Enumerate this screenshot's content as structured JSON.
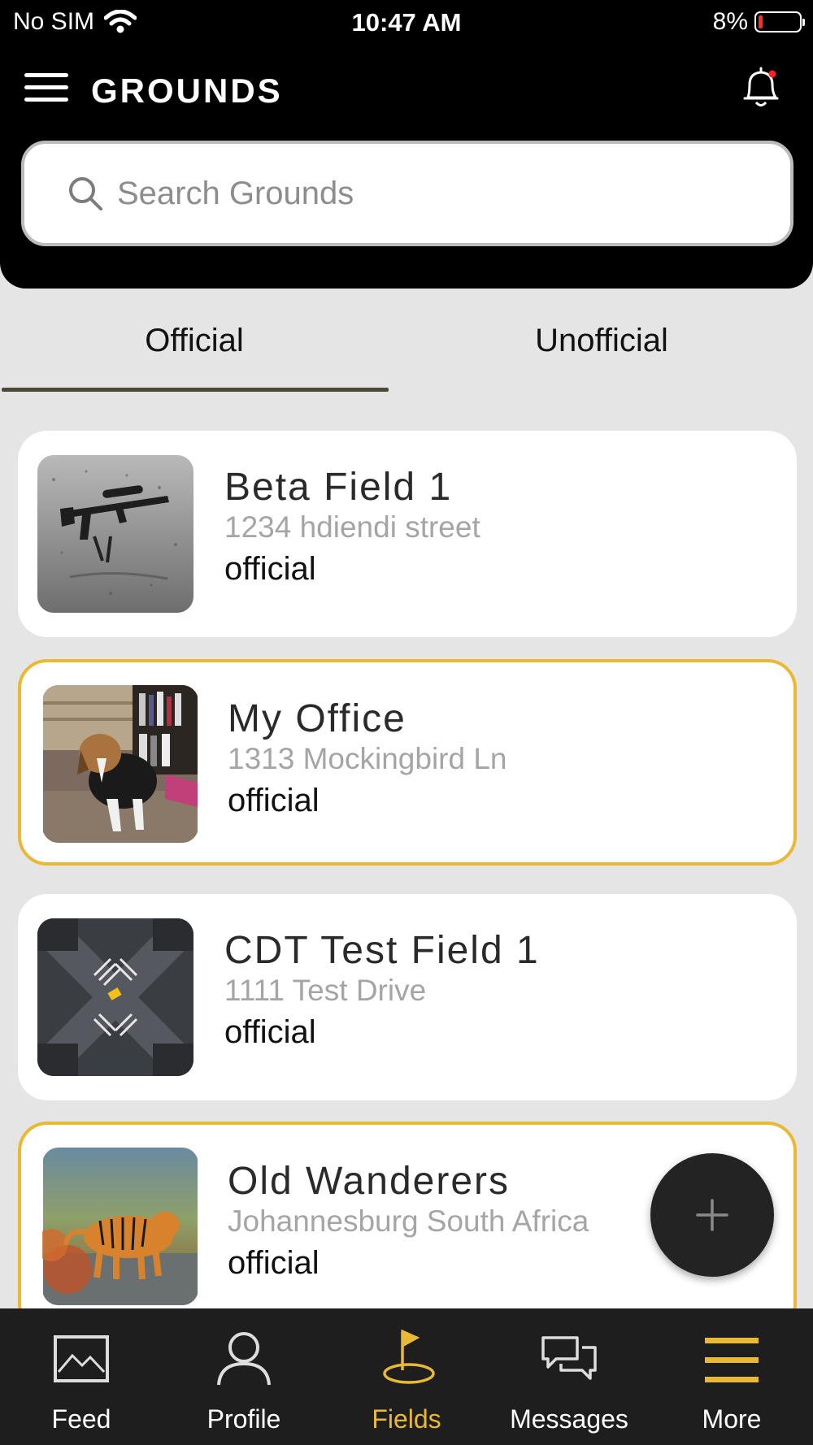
{
  "status_bar": {
    "carrier": "No SIM",
    "time": "10:47 AM",
    "battery": "8%"
  },
  "header": {
    "title": "GROUNDS"
  },
  "search": {
    "placeholder": "Search Grounds",
    "value": ""
  },
  "tabs": [
    {
      "label": "Official",
      "selected": true
    },
    {
      "label": "Unofficial",
      "selected": false
    }
  ],
  "grounds": [
    {
      "name": "Beta Field 1",
      "address": "1234 hdiendi street",
      "type": "official",
      "thumbnail": "rifle-in-rain-photo",
      "highlighted": false
    },
    {
      "name": "My Office",
      "address": "1313 Mockingbird Ln",
      "type": "official",
      "thumbnail": "beagle-dog-photo",
      "highlighted": true
    },
    {
      "name": "CDT Test Field 1",
      "address": "1111 Test Drive",
      "type": "official",
      "thumbnail": "aerial-intersection-photo",
      "highlighted": false
    },
    {
      "name": "Old Wanderers",
      "address": "Johannesburg South Africa",
      "type": "official",
      "thumbnail": "tiger-photo",
      "highlighted": true
    }
  ],
  "fab": {
    "icon": "plus-icon"
  },
  "bottom_nav": [
    {
      "label": "Feed",
      "icon": "image-icon",
      "active": false
    },
    {
      "label": "Profile",
      "icon": "person-icon",
      "active": false
    },
    {
      "label": "Fields",
      "icon": "golf-flag-icon",
      "active": true
    },
    {
      "label": "Messages",
      "icon": "chat-bubbles-icon",
      "active": false
    },
    {
      "label": "More",
      "icon": "hamburger-icon",
      "active": false
    }
  ],
  "colors": {
    "accent": "#e9b936",
    "header_bg": "#000000",
    "page_bg": "#e5e5e5",
    "nav_bg": "#1e1e1e",
    "battery_low": "#ff2d2d",
    "notification_dot": "#ff2020"
  }
}
